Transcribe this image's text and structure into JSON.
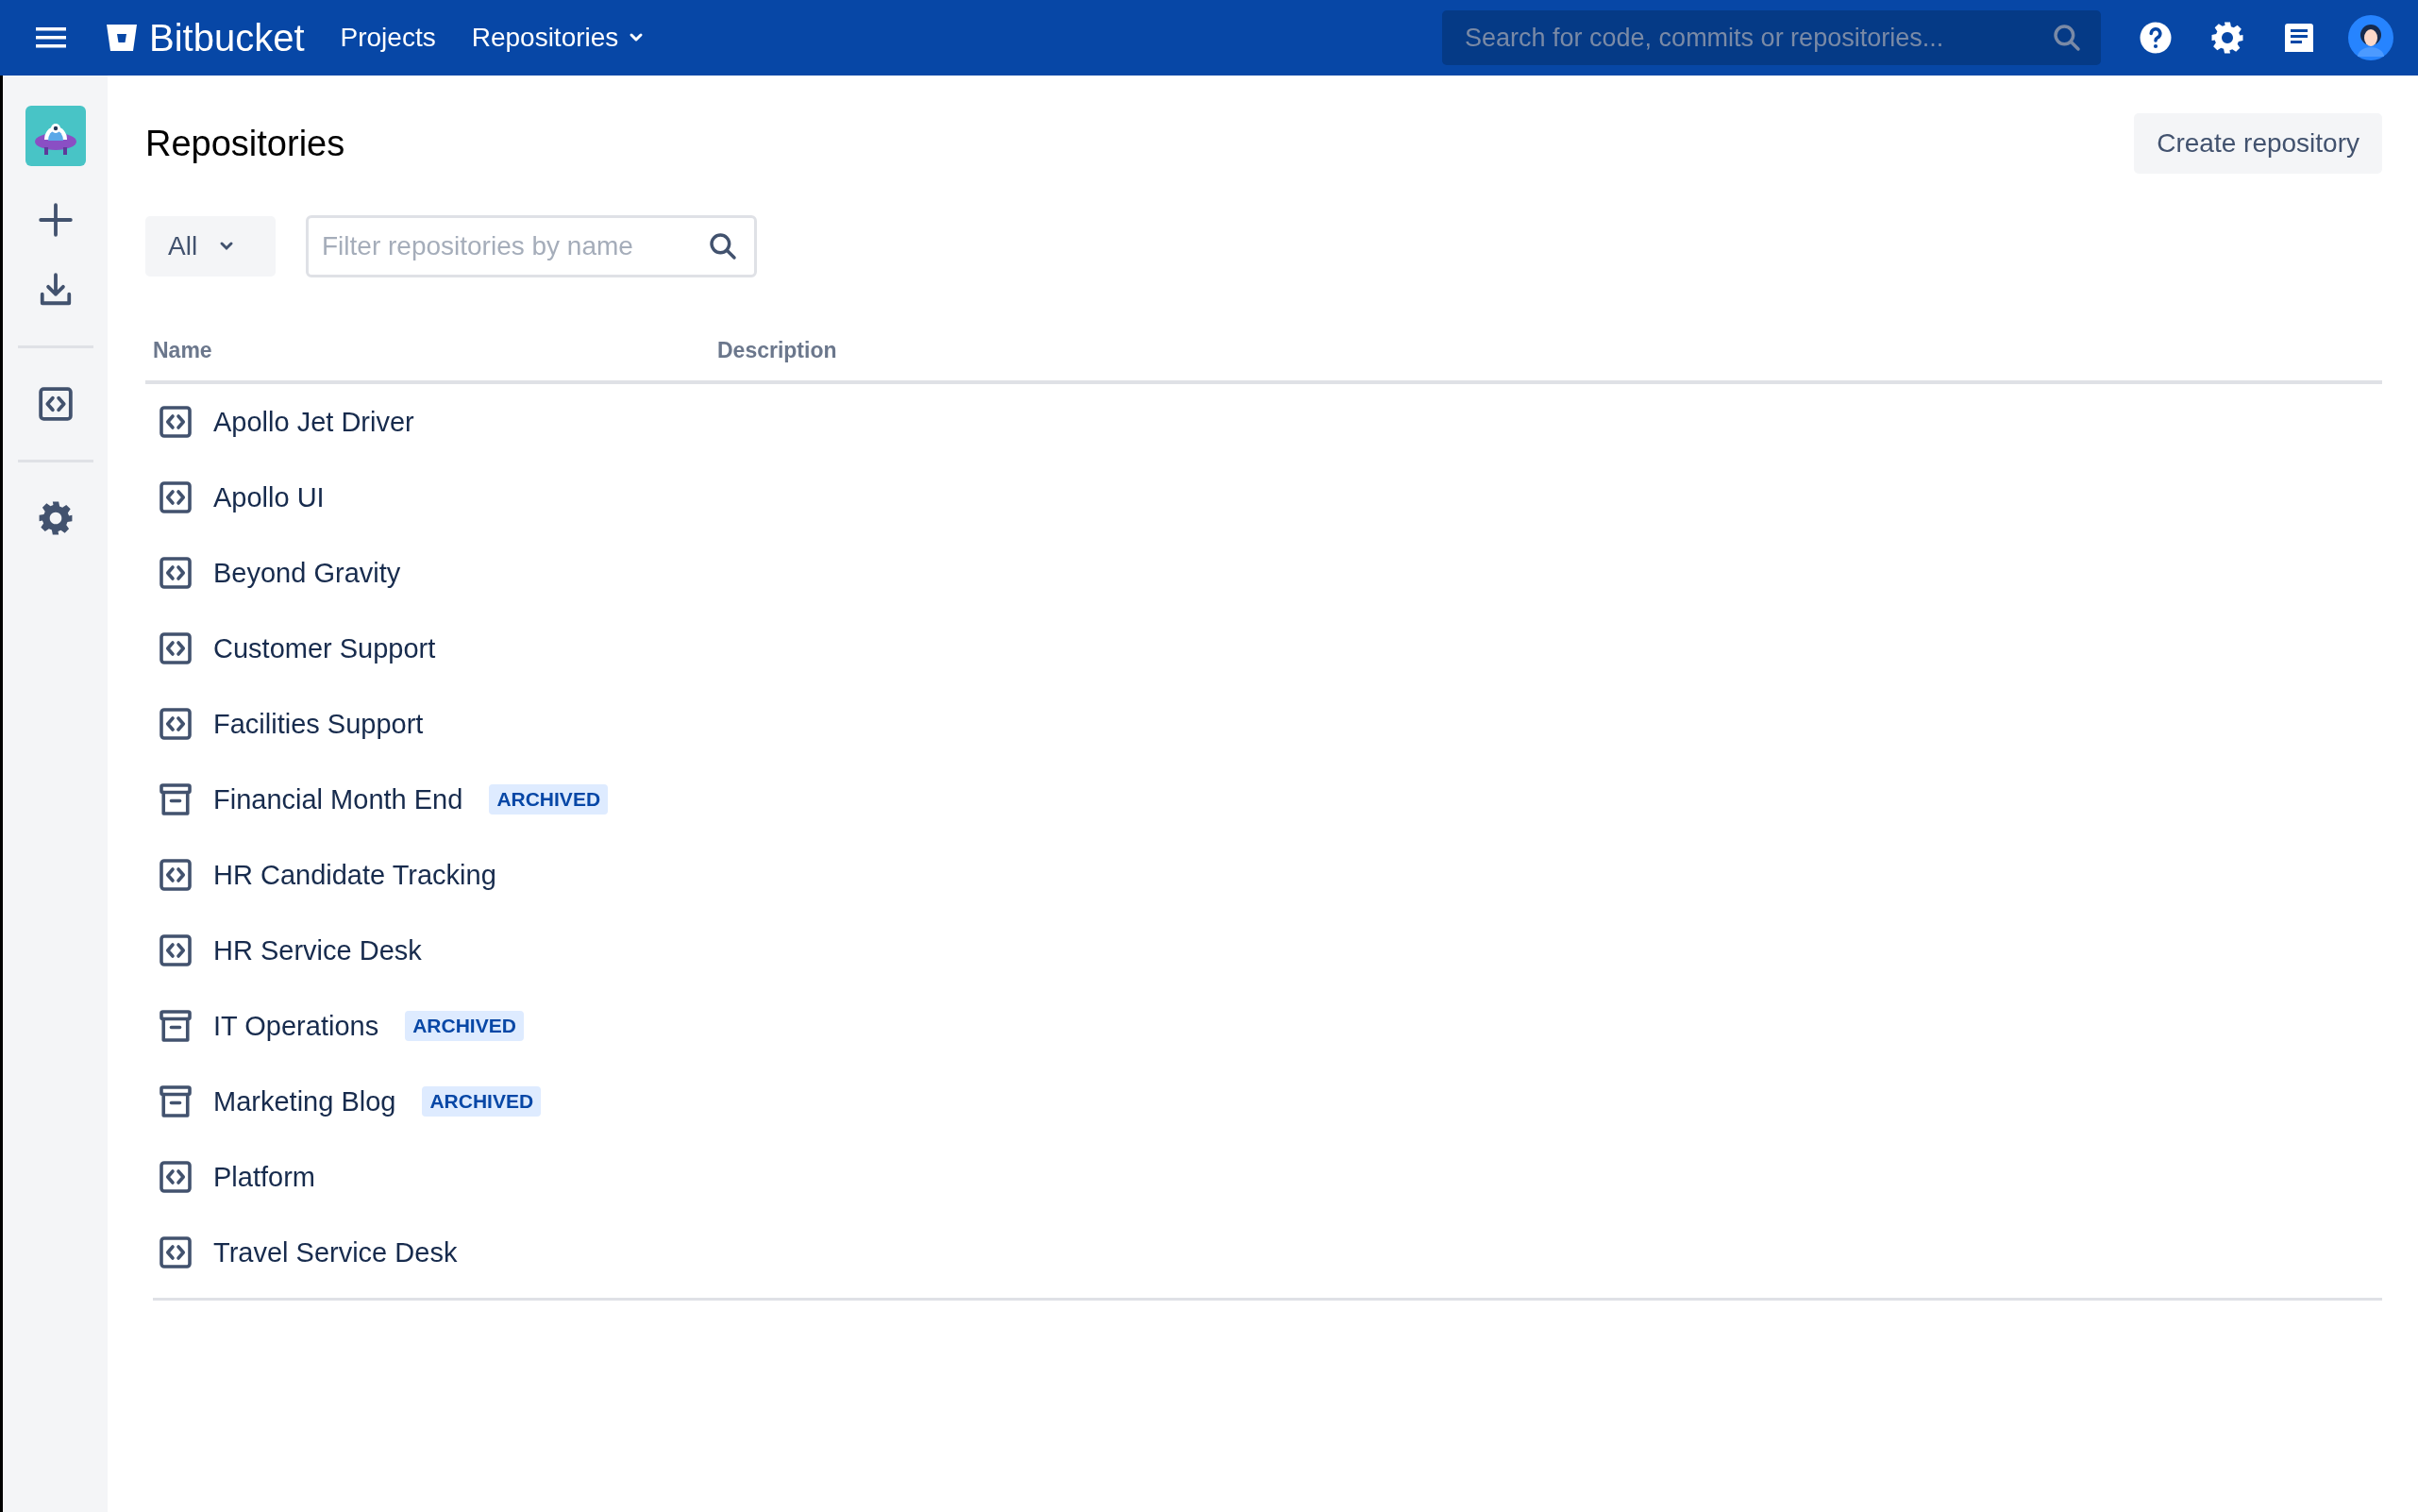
{
  "header": {
    "product": "Bitbucket",
    "nav": [
      {
        "label": "Projects",
        "has_menu": false
      },
      {
        "label": "Repositories",
        "has_menu": true
      }
    ],
    "search": {
      "placeholder": "Search for code, commits or repositories..."
    }
  },
  "page": {
    "title": "Repositories",
    "create_button": "Create repository"
  },
  "filter": {
    "scope": "All",
    "search": {
      "placeholder": "Filter repositories by name"
    }
  },
  "table": {
    "columns": [
      "Name",
      "Description"
    ],
    "rows": [
      {
        "name": "Apollo Jet Driver",
        "kind": "repository"
      },
      {
        "name": "Apollo UI",
        "kind": "repository"
      },
      {
        "name": "Beyond Gravity",
        "kind": "repository"
      },
      {
        "name": "Customer Support",
        "kind": "repository"
      },
      {
        "name": "Facilities Support",
        "kind": "repository"
      },
      {
        "name": "Financial Month End",
        "kind": "archived",
        "badge": "ARCHIVED"
      },
      {
        "name": "HR Candidate Tracking",
        "kind": "repository"
      },
      {
        "name": "HR Service Desk",
        "kind": "repository"
      },
      {
        "name": "IT Operations",
        "kind": "archived",
        "badge": "ARCHIVED"
      },
      {
        "name": "Marketing Blog",
        "kind": "archived",
        "badge": "ARCHIVED"
      },
      {
        "name": "Platform",
        "kind": "repository"
      },
      {
        "name": "Travel Service Desk",
        "kind": "repository"
      }
    ]
  }
}
